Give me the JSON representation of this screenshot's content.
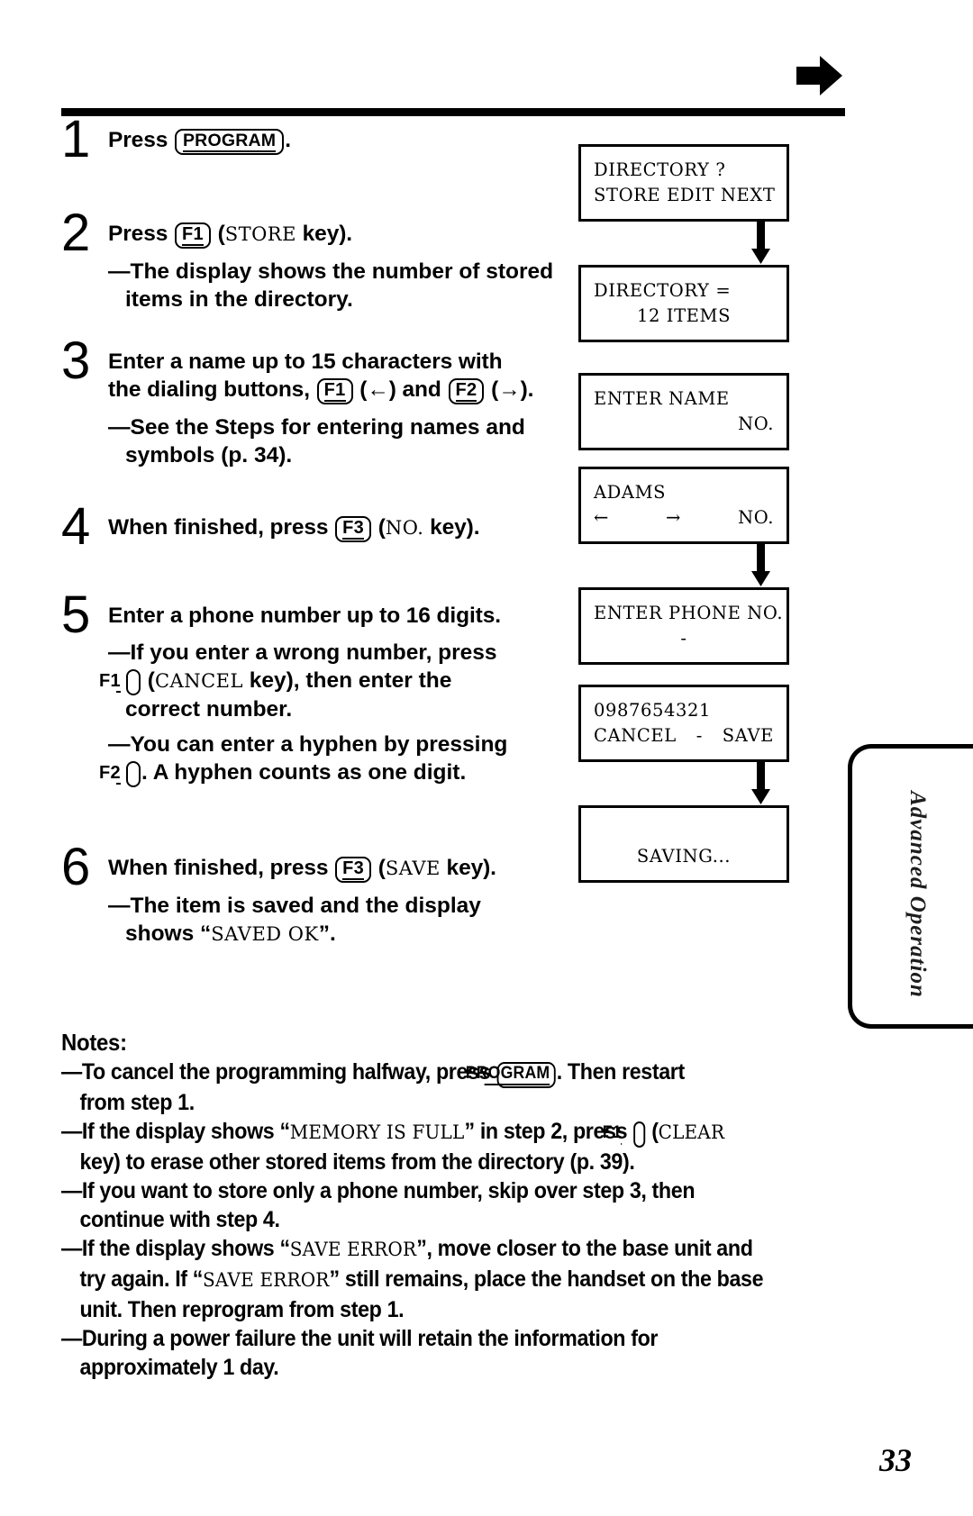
{
  "page": {
    "number": "33",
    "side_tab_label": "Advanced Operation",
    "top_marker_icon": "right-arrow-icon"
  },
  "steps": [
    {
      "num": "1",
      "lines": [
        {
          "parts": [
            {
              "t": "text",
              "v": "Press "
            },
            {
              "t": "key",
              "v": "PROGRAM",
              "wide": true
            },
            {
              "t": "text",
              "v": "."
            }
          ]
        }
      ],
      "subs": []
    },
    {
      "num": "2",
      "lines": [
        {
          "parts": [
            {
              "t": "text",
              "v": "Press "
            },
            {
              "t": "key",
              "v": "F1"
            },
            {
              "t": "text",
              "v": " ("
            },
            {
              "t": "mono",
              "v": "STORE"
            },
            {
              "t": "text",
              "v": " key)."
            }
          ]
        }
      ],
      "subs": [
        {
          "text": "—The display shows the number of stored items in the directory."
        }
      ]
    },
    {
      "num": "3",
      "lines": [
        {
          "parts": [
            {
              "t": "text",
              "v": "Enter a name up to 15 characters with"
            }
          ]
        },
        {
          "parts": [
            {
              "t": "text",
              "v": "the dialing buttons, "
            },
            {
              "t": "key",
              "v": "F1"
            },
            {
              "t": "text",
              "v": " (←) and "
            },
            {
              "t": "key",
              "v": "F2"
            },
            {
              "t": "text",
              "v": " (→)."
            }
          ]
        }
      ],
      "subs": [
        {
          "text": "—See the Steps for entering names and symbols (p. 34)."
        }
      ]
    },
    {
      "num": "4",
      "lines": [
        {
          "parts": [
            {
              "t": "text",
              "v": "When finished, press "
            },
            {
              "t": "key",
              "v": "F3"
            },
            {
              "t": "text",
              "v": " ("
            },
            {
              "t": "mono",
              "v": "NO."
            },
            {
              "t": "text",
              "v": " key)."
            }
          ]
        }
      ],
      "subs": []
    },
    {
      "num": "5",
      "lines": [
        {
          "parts": [
            {
              "t": "text",
              "v": "Enter a phone number up to 16 digits."
            }
          ]
        }
      ],
      "subs": [
        {
          "parts": [
            {
              "t": "text",
              "v": "—If you enter a wrong number, press "
            },
            {
              "t": "br"
            },
            {
              "t": "key",
              "v": "F1"
            },
            {
              "t": "text",
              "v": " ("
            },
            {
              "t": "mono",
              "v": "CANCEL"
            },
            {
              "t": "text",
              "v": " key), then enter the "
            },
            {
              "t": "br"
            },
            {
              "t": "text",
              "v": "correct number."
            }
          ]
        },
        {
          "parts": [
            {
              "t": "text",
              "v": "—You can enter a hyphen by pressing "
            },
            {
              "t": "br"
            },
            {
              "t": "key",
              "v": "F2"
            },
            {
              "t": "text",
              "v": ". A hyphen counts as one digit."
            }
          ]
        }
      ]
    },
    {
      "num": "6",
      "lines": [
        {
          "parts": [
            {
              "t": "text",
              "v": "When finished, press "
            },
            {
              "t": "key",
              "v": "F3"
            },
            {
              "t": "text",
              "v": " ("
            },
            {
              "t": "mono",
              "v": "SAVE"
            },
            {
              "t": "text",
              "v": " key)."
            }
          ]
        }
      ],
      "subs": [
        {
          "parts": [
            {
              "t": "text",
              "v": "—The item is saved and the display "
            },
            {
              "t": "br"
            },
            {
              "t": "text",
              "v": "shows “"
            },
            {
              "t": "mono",
              "v": "SAVED OK"
            },
            {
              "t": "text",
              "v": "”."
            }
          ]
        }
      ]
    }
  ],
  "displays": [
    {
      "id": "directory-prompt",
      "line1": "DIRECTORY ?",
      "line2": "STORE EDIT NEXT",
      "line1_align": "left",
      "line2_align": "left",
      "arrow_after": true
    },
    {
      "id": "directory-count",
      "line1": "DIRECTORY =",
      "line2": "12 ITEMS",
      "line1_align": "left",
      "line2_align": "center",
      "arrow_after": false
    },
    {
      "id": "enter-name",
      "line1": "ENTER NAME",
      "line2": "NO.",
      "line1_align": "left",
      "line2_align": "right",
      "arrow_after": false
    },
    {
      "id": "name-entered",
      "line1": "ADAMS",
      "line2_left": "←",
      "line2_mid": "→",
      "line2_right": "NO.",
      "line1_align": "left",
      "line2_align": "split",
      "arrow_after": true
    },
    {
      "id": "enter-phone",
      "line1": "ENTER PHONE NO.",
      "line2": "-",
      "line1_align": "left",
      "line2_align": "center",
      "arrow_after": false
    },
    {
      "id": "phone-entered",
      "line1": "0987654321",
      "line2_left": "CANCEL",
      "line2_mid": "-",
      "line2_right": "SAVE",
      "line1_align": "left",
      "line2_align": "split",
      "arrow_after": true
    },
    {
      "id": "saving",
      "line1": "",
      "line2": "SAVING...",
      "line1_align": "left",
      "line2_align": "center",
      "arrow_after": false
    }
  ],
  "notes": {
    "title": "Notes:",
    "items": [
      {
        "id": "note-cancel-programming",
        "parts": [
          {
            "t": "text",
            "v": "—To cancel the programming halfway, press "
          },
          {
            "t": "key",
            "v": "PROGRAM",
            "wide": true
          },
          {
            "t": "text",
            "v": ". Then restart "
          },
          {
            "t": "br"
          },
          {
            "t": "text",
            "v": "from step 1."
          }
        ]
      },
      {
        "id": "note-memory-full",
        "parts": [
          {
            "t": "text",
            "v": "—If the display shows “"
          },
          {
            "t": "mono",
            "v": "MEMORY IS FULL"
          },
          {
            "t": "text",
            "v": "” in step 2, press "
          },
          {
            "t": "key",
            "v": "F1"
          },
          {
            "t": "text",
            "v": " ("
          },
          {
            "t": "mono",
            "v": "CLEAR"
          },
          {
            "t": "br"
          },
          {
            "t": "text",
            "v": "key) to erase other stored items from the directory (p. 39)."
          }
        ]
      },
      {
        "id": "note-phone-only",
        "parts": [
          {
            "t": "text",
            "v": "—If you want to store only a phone number, skip over step 3, then "
          },
          {
            "t": "br"
          },
          {
            "t": "text",
            "v": "continue with step 4."
          }
        ]
      },
      {
        "id": "note-save-error",
        "parts": [
          {
            "t": "text",
            "v": "—If the display shows “"
          },
          {
            "t": "mono",
            "v": "SAVE ERROR"
          },
          {
            "t": "text",
            "v": "”, move closer to the base unit and "
          },
          {
            "t": "br"
          },
          {
            "t": "text",
            "v": "try again. If “"
          },
          {
            "t": "mono",
            "v": "SAVE ERROR"
          },
          {
            "t": "text",
            "v": "” still remains, place the handset on the base "
          },
          {
            "t": "br"
          },
          {
            "t": "text",
            "v": "unit. Then reprogram from step 1."
          }
        ]
      },
      {
        "id": "note-power-failure",
        "parts": [
          {
            "t": "text",
            "v": "—During a power failure the unit will retain the information for "
          },
          {
            "t": "br"
          },
          {
            "t": "text",
            "v": "approximately 1 day."
          }
        ]
      }
    ]
  }
}
